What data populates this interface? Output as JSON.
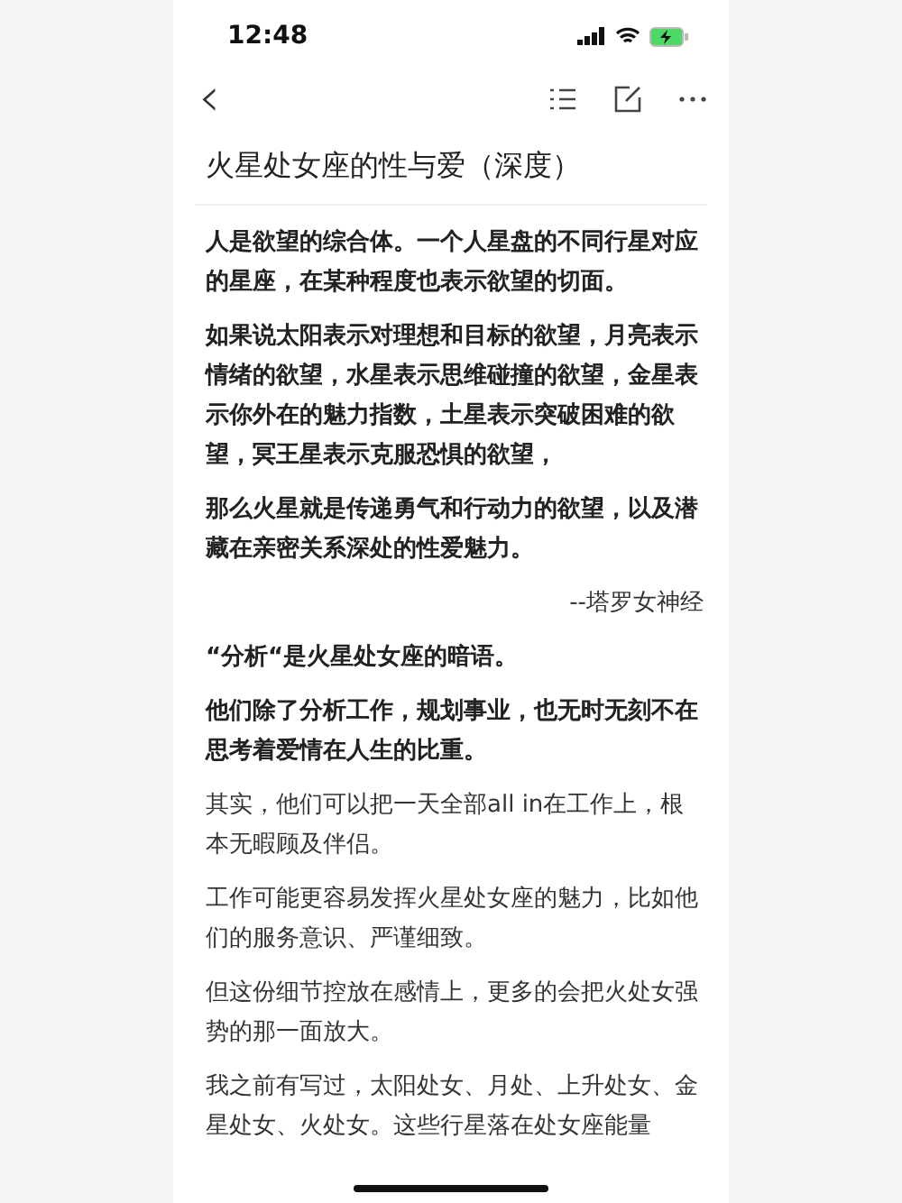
{
  "status_bar": {
    "time": "12:48"
  },
  "nav": {
    "back": "‹"
  },
  "title": "火星处女座的性与爱（深度）",
  "paragraphs": [
    {
      "kind": "text",
      "bold": true,
      "text": "人是欲望的综合体。一个人星盘的不同行星对应的星座，在某种程度也表示欲望的切面。"
    },
    {
      "kind": "text",
      "bold": true,
      "text": "如果说太阳表示对理想和目标的欲望，月亮表示情绪的欲望，水星表示思维碰撞的欲望，金星表示你外在的魅力指数，土星表示突破困难的欲望，冥王星表示克服恐惧的欲望，"
    },
    {
      "kind": "text",
      "bold": true,
      "text": "那么火星就是传递勇气和行动力的欲望，以及潜藏在亲密关系深处的性爱魅力。"
    },
    {
      "kind": "quote",
      "bold": false,
      "text": "--塔罗女神经"
    },
    {
      "kind": "text",
      "bold": true,
      "text": "“分析“是火星处女座的暗语。"
    },
    {
      "kind": "text",
      "bold": true,
      "text": "他们除了分析工作，规划事业，也无时无刻不在思考着爱情在人生的比重。"
    },
    {
      "kind": "text",
      "bold": false,
      "text": "其实，他们可以把一天全部all in在工作上，根本无暇顾及伴侣。"
    },
    {
      "kind": "text",
      "bold": false,
      "text": "工作可能更容易发挥火星处女座的魅力，比如他们的服务意识、严谨细致。"
    },
    {
      "kind": "text",
      "bold": false,
      "text": "但这份细节控放在感情上，更多的会把火处女强势的那一面放大。"
    },
    {
      "kind": "text",
      "bold": false,
      "text": "我之前有写过，太阳处女、月处、上升处女、金星处女、火处女。这些行星落在处女座能量"
    }
  ]
}
